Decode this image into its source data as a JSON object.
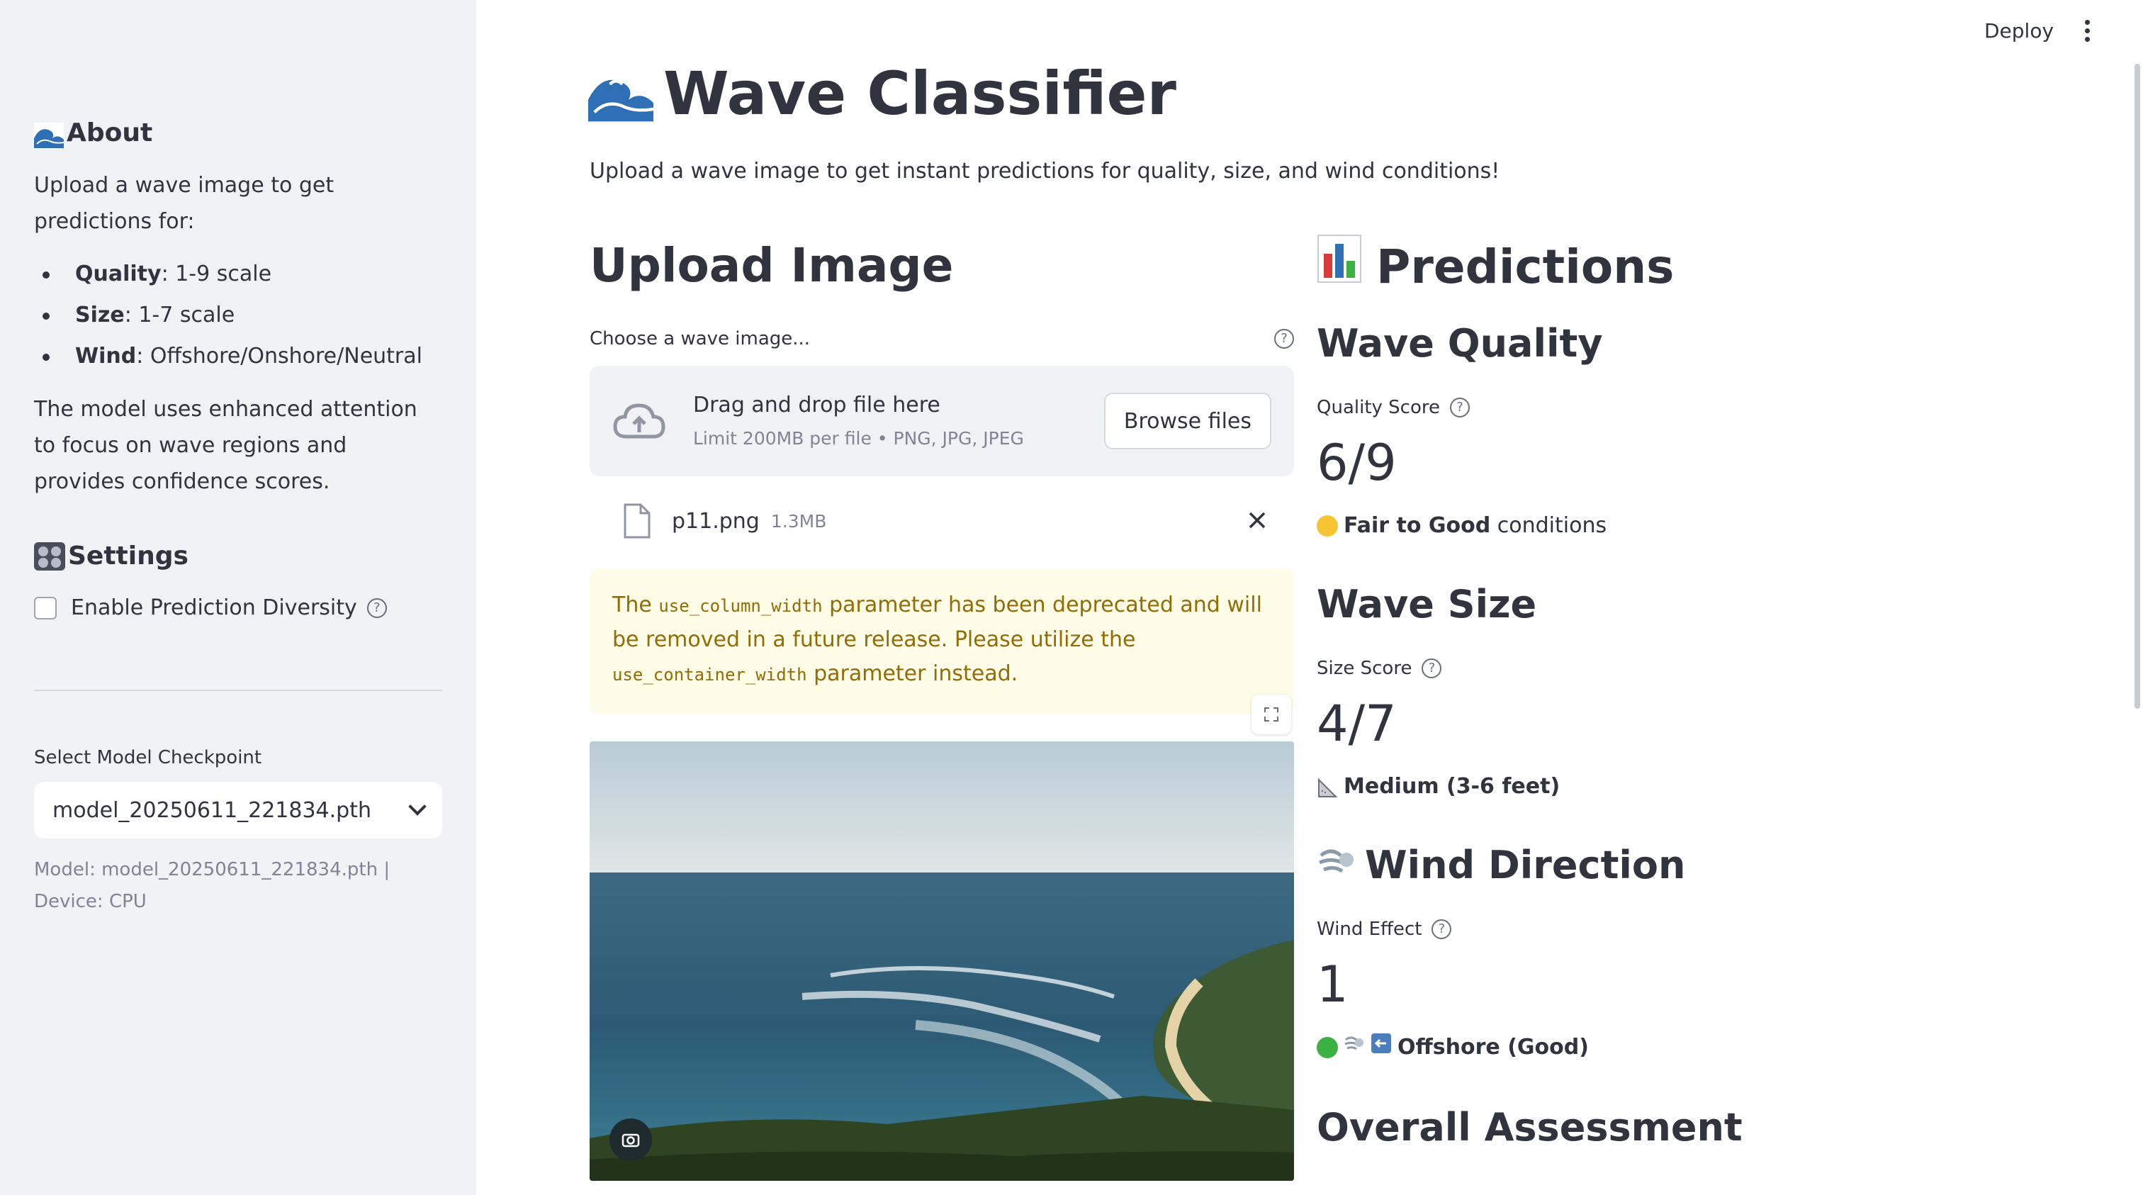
{
  "header": {
    "deploy_label": "Deploy"
  },
  "sidebar": {
    "about_heading": "About",
    "about_text": "Upload a wave image to get predictions for:",
    "items": [
      {
        "label": "Quality",
        "value": ": 1-9 scale"
      },
      {
        "label": "Size",
        "value": ": 1-7 scale"
      },
      {
        "label": "Wind",
        "value": ": Offshore/Onshore/Neutral"
      }
    ],
    "model_text": "The model uses enhanced attention to focus on wave regions and provides confidence scores.",
    "settings_heading": "Settings",
    "diversity_label": "Enable Prediction Diversity",
    "diversity_checked": false,
    "checkpoint_label": "Select Model Checkpoint",
    "checkpoint_value": "model_20250611_221834.pth",
    "caption": "Model: model_20250611_221834.pth | Device: CPU"
  },
  "main": {
    "title": "Wave Classifier",
    "subtitle": "Upload a wave image to get instant predictions for quality, size, and wind conditions!",
    "upload_heading": "Upload Image",
    "uploader_label": "Choose a wave image...",
    "dropzone_title": "Drag and drop file here",
    "dropzone_limit": "Limit 200MB per file • PNG, JPG, JPEG",
    "browse_label": "Browse files",
    "file_name": "p11.png",
    "file_size": "1.3MB",
    "warning": {
      "pre": "The ",
      "code1": "use_column_width",
      "mid": " parameter has been deprecated and will be removed in a future release. Please utilize the ",
      "code2": "use_container_width",
      "post": " parameter instead."
    },
    "predictions_heading": "Predictions",
    "quality": {
      "heading": "Wave Quality",
      "label": "Quality Score",
      "value": "6/9",
      "status_bold": "Fair to Good",
      "status_rest": " conditions",
      "dot_color": "#f7c531"
    },
    "size": {
      "heading": "Wave Size",
      "label": "Size Score",
      "value": "4/7",
      "status_bold": "Medium (3-6 feet)"
    },
    "wind": {
      "heading": "Wind Direction",
      "label": "Wind Effect",
      "value": "1",
      "status_bold": "Offshore (Good)",
      "dot_color": "#3cb043"
    },
    "overall_heading": "Overall Assessment"
  },
  "colors": {
    "sidebar_bg": "#f0f2f6",
    "text": "#31333f",
    "warning_bg": "#fffce7",
    "warning_text": "#926c05"
  }
}
